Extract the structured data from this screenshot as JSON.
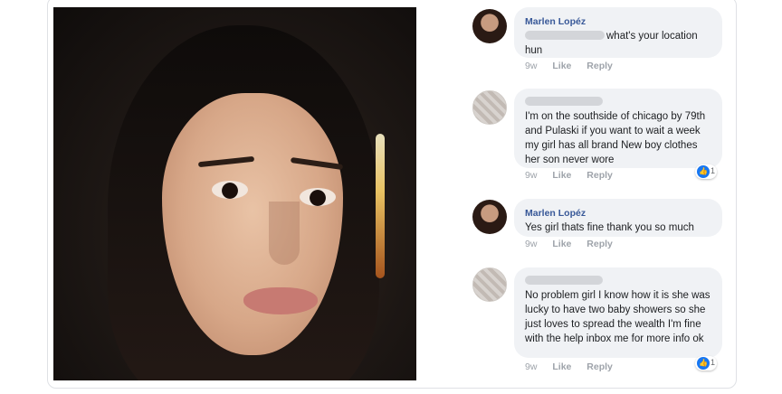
{
  "post": {
    "comments": [
      {
        "author": "Marlen Lopéz",
        "text": "what's your location hun",
        "time": "9w",
        "like_label": "Like",
        "reply_label": "Reply"
      },
      {
        "author": "",
        "text": "I'm on the southside of chicago by 79th and Pulaski if you want to wait a week my girl has all brand New boy clothes her son never wore",
        "time": "9w",
        "like_label": "Like",
        "reply_label": "Reply",
        "reactions": "1"
      },
      {
        "author": "Marlen Lopéz",
        "text": "Yes girl thats fine thank you so much",
        "time": "9w",
        "like_label": "Like",
        "reply_label": "Reply"
      },
      {
        "author": "",
        "text": "No problem girl I know how it is she was lucky to have two baby showers so she just loves to spread the wealth I'm fine with the help inbox me for more info ok",
        "time": "9w",
        "like_label": "Like",
        "reply_label": "Reply",
        "reactions": "1"
      }
    ]
  },
  "colors": {
    "bubble": "#f0f2f5",
    "author_name": "#385898",
    "meta": "#9ea3aa",
    "like_badge": "#1877f2"
  },
  "icons": {
    "reaction": "thumbs-up-icon"
  }
}
